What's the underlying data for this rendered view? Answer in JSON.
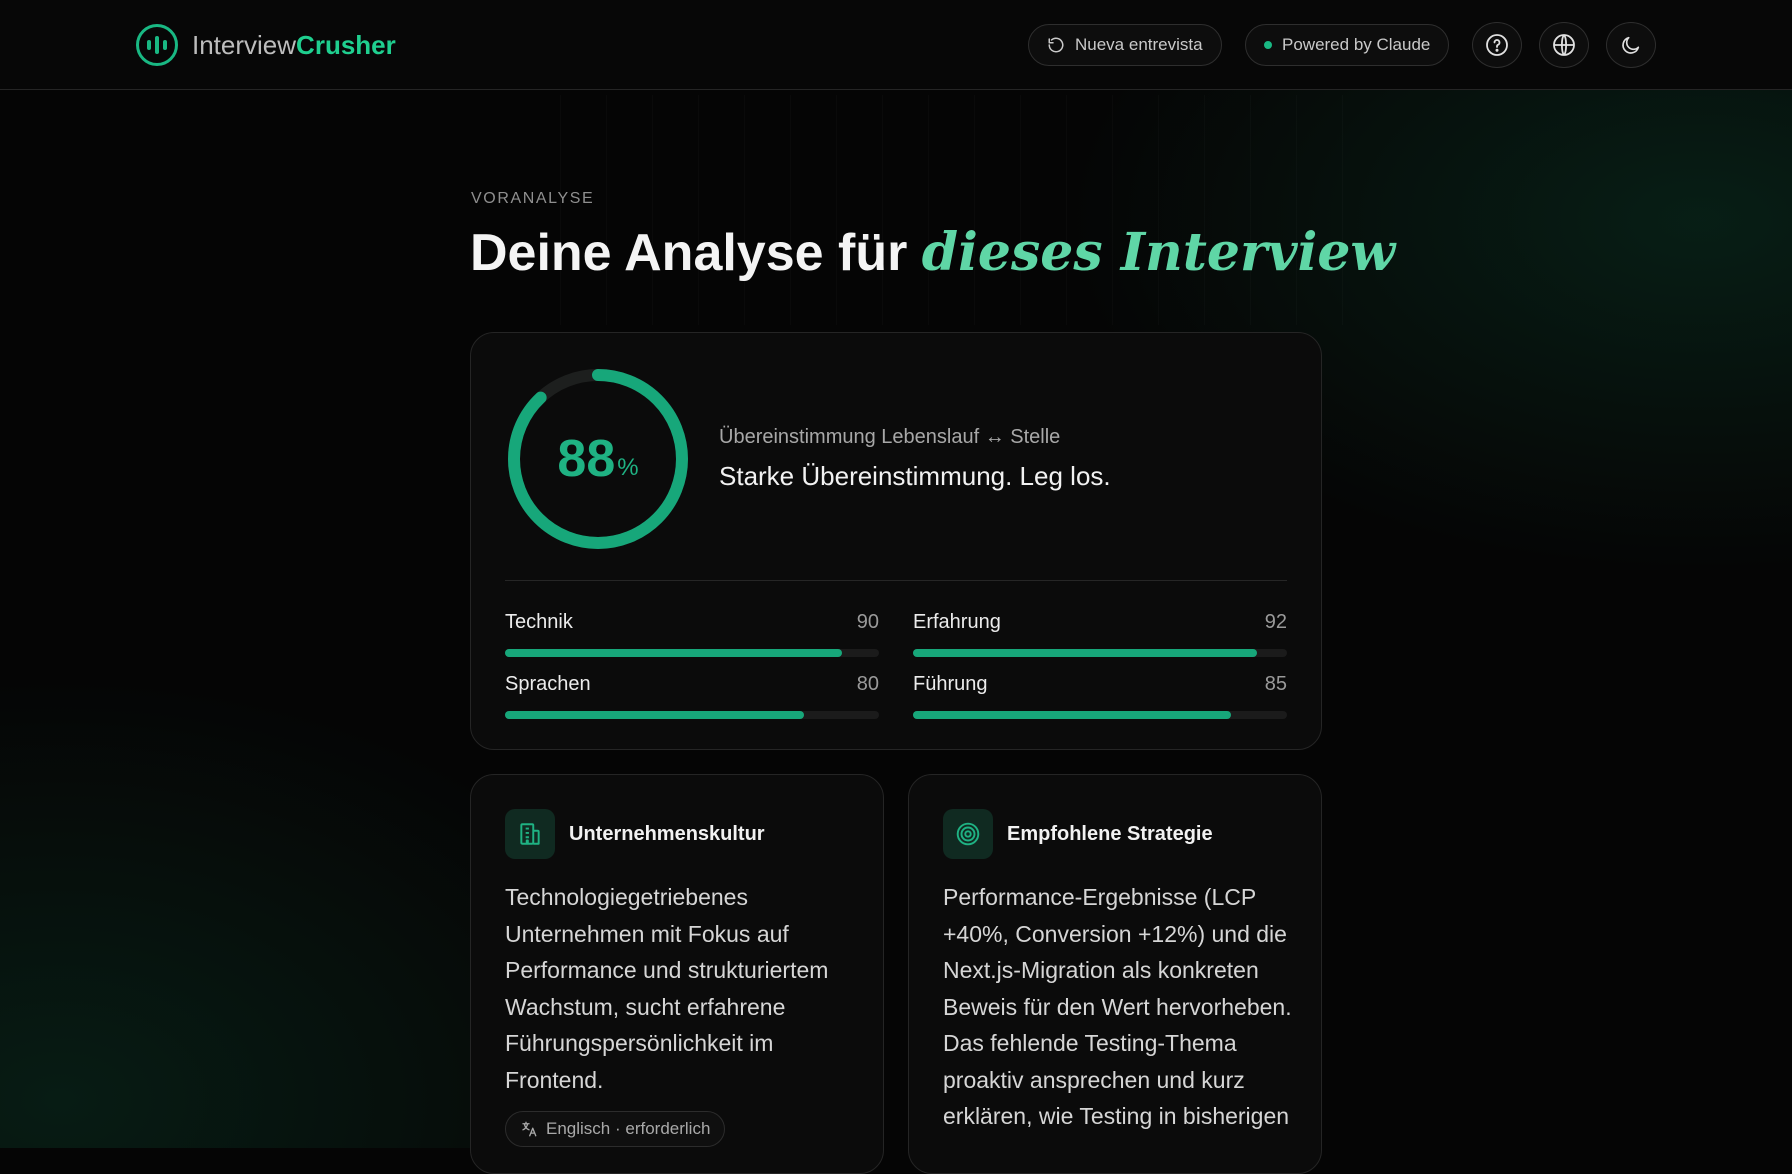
{
  "brand": {
    "name_part1": "Interview",
    "name_part2": "Crusher"
  },
  "header": {
    "new_interview_label": "Nueva entrevista",
    "powered_label": "Powered by Claude",
    "icons": [
      "help-icon",
      "globe-icon",
      "moon-icon"
    ]
  },
  "page": {
    "eyebrow": "VORANALYSE",
    "title_main": "Deine Analyse für",
    "title_accent": "dieses Interview"
  },
  "match": {
    "score": 88,
    "score_text": "88",
    "percent_sign": "%",
    "label": "Übereinstimmung Lebenslauf ↔ Stelle",
    "verdict": "Starke Übereinstimmung. Leg los."
  },
  "metrics": [
    {
      "label": "Technik",
      "value": 90,
      "value_text": "90"
    },
    {
      "label": "Erfahrung",
      "value": 92,
      "value_text": "92"
    },
    {
      "label": "Sprachen",
      "value": 80,
      "value_text": "80"
    },
    {
      "label": "Führung",
      "value": 85,
      "value_text": "85"
    }
  ],
  "cards": {
    "culture": {
      "title": "Unternehmenskultur",
      "icon": "building-icon",
      "body": "Technologiegetriebenes Unternehmen mit Fokus auf Performance und strukturiertem Wachstum, sucht erfahrene Führungspersönlichkeit im Frontend.",
      "tag": "Englisch · erforderlich"
    },
    "strategy": {
      "title": "Empfohlene Strategie",
      "icon": "target-icon",
      "body": "Performance-Ergebnisse (LCP +40%, Conversion +12%) und die Next.js-Migration als konkreten Beweis für den Wert hervorheben. Das fehlende Testing-Thema proaktiv ansprechen und kurz erklären, wie Testing in bisherigen"
    }
  },
  "colors": {
    "accent": "#19b883",
    "background": "#050505",
    "card": "#0b0b0b"
  }
}
